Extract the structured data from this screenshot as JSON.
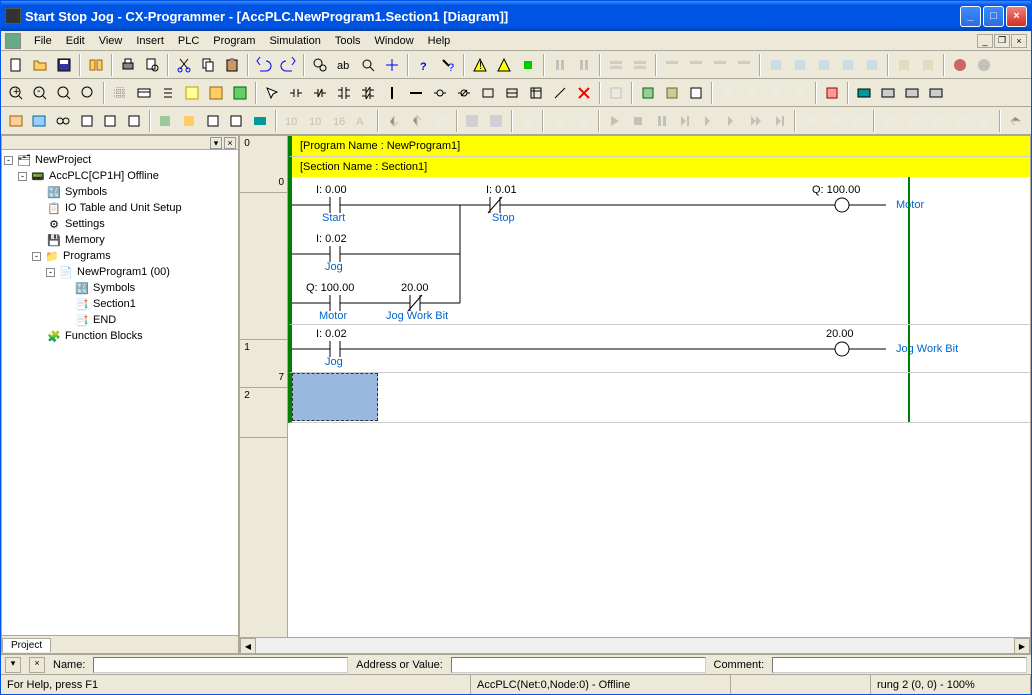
{
  "title": "Start Stop Jog - CX-Programmer - [AccPLC.NewProgram1.Section1 [Diagram]]",
  "menu": {
    "file": "File",
    "edit": "Edit",
    "view": "View",
    "insert": "Insert",
    "plc": "PLC",
    "program": "Program",
    "simulation": "Simulation",
    "tools": "Tools",
    "window": "Window",
    "help": "Help"
  },
  "tree": {
    "root": "NewProject",
    "plc": "AccPLC[CP1H] Offline",
    "symbols": "Symbols",
    "iotable": "IO Table and Unit Setup",
    "settings": "Settings",
    "memory": "Memory",
    "programs": "Programs",
    "newprogram": "NewProgram1 (00)",
    "prog_symbols": "Symbols",
    "section1": "Section1",
    "end": "END",
    "fblocks": "Function Blocks",
    "tab": "Project"
  },
  "diagram": {
    "prog_name_label": "[Program Name : NewProgram1]",
    "section_label": "[Section Name : Section1]",
    "rung0": {
      "num": "0",
      "step": "0",
      "contacts": [
        {
          "addr": "I: 0.00",
          "comment": "Start",
          "type": "NO"
        },
        {
          "addr": "I: 0.01",
          "comment": "Stop",
          "type": "NC"
        },
        {
          "addr": "I: 0.02",
          "comment": "Jog",
          "type": "NO"
        },
        {
          "addr": "Q: 100.00",
          "comment": "Motor",
          "type": "NO"
        },
        {
          "addr": "20.00",
          "comment": "Jog Work Bit",
          "type": "NC"
        }
      ],
      "coil": {
        "addr": "Q: 100.00",
        "comment": "Motor"
      }
    },
    "rung1": {
      "num": "1",
      "step": "7",
      "contact": {
        "addr": "I: 0.02",
        "comment": "Jog"
      },
      "coil": {
        "addr": "20.00",
        "comment": "Jog Work Bit"
      }
    },
    "rung2": {
      "num": "2"
    }
  },
  "infobar": {
    "name": "Name:",
    "addr": "Address or Value:",
    "comment": "Comment:"
  },
  "status": {
    "help": "For Help, press F1",
    "plc": "AccPLC(Net:0,Node:0) - Offline",
    "rung": "rung 2 (0, 0) - 100%"
  }
}
